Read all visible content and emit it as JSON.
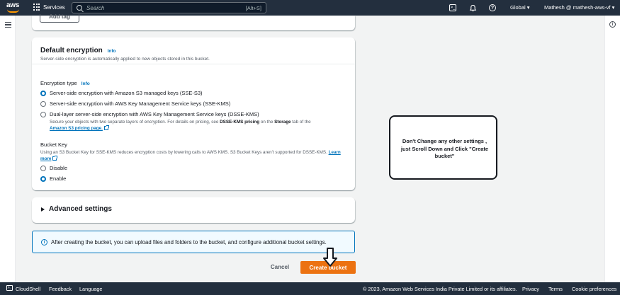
{
  "nav": {
    "logo": "aws",
    "services_label": "Services",
    "search_placeholder": "Search",
    "search_shortcut": "[Alt+S]",
    "region": "Global",
    "account": "Mathesh @ mathesh-aws-vf",
    "brand_color": "#232f3e",
    "accent_color": "#ff9900"
  },
  "tags": {
    "add_tag_label": "Add tag"
  },
  "encryption": {
    "title": "Default encryption",
    "info_label": "Info",
    "description": "Server-side encryption is automatically applied to new objects stored in this bucket.",
    "type_label": "Encryption type",
    "type_info_label": "Info",
    "options": [
      {
        "label": "Server-side encryption with Amazon S3 managed keys (SSE-S3)",
        "selected": true
      },
      {
        "label": "Server-side encryption with AWS Key Management Service keys (SSE-KMS)",
        "selected": false
      },
      {
        "label": "Dual-layer server-side encryption with AWS Key Management Service keys (DSSE-KMS)",
        "selected": false
      }
    ],
    "dsse_desc_prefix": "Secure your objects with two separate layers of encryption. For details on pricing, see ",
    "dsse_desc_bold1": "DSSE-KMS pricing",
    "dsse_desc_mid": " on the ",
    "dsse_desc_bold2": "Storage",
    "dsse_desc_suffix": " tab of the ",
    "dsse_desc_link": "Amazon S3 pricing page.",
    "bucket_key_label": "Bucket Key",
    "bucket_key_desc": "Using an S3 Bucket Key for SSE-KMS reduces encryption costs by lowering calls to AWS KMS. S3 Bucket Keys aren't supported for DSSE-KMS. ",
    "bucket_key_link": "Learn more",
    "bucket_key_options": [
      {
        "label": "Disable",
        "selected": false
      },
      {
        "label": "Enable",
        "selected": true
      }
    ]
  },
  "advanced": {
    "title": "Advanced settings"
  },
  "banner": {
    "text": "After creating the bucket, you can upload files and folders to the bucket, and configure additional bucket settings."
  },
  "actions": {
    "cancel_label": "Cancel",
    "create_label": "Create bucket",
    "create_color": "#ec7211"
  },
  "annotation": {
    "text": "Don't Change any other settings , just Scroll Down and Click \"Create bucket\""
  },
  "footer": {
    "cloudshell": "CloudShell",
    "feedback": "Feedback",
    "language": "Language",
    "copyright": "© 2023, Amazon Web Services India Private Limited or its affiliates.",
    "privacy": "Privacy",
    "terms": "Terms",
    "cookies": "Cookie preferences"
  }
}
